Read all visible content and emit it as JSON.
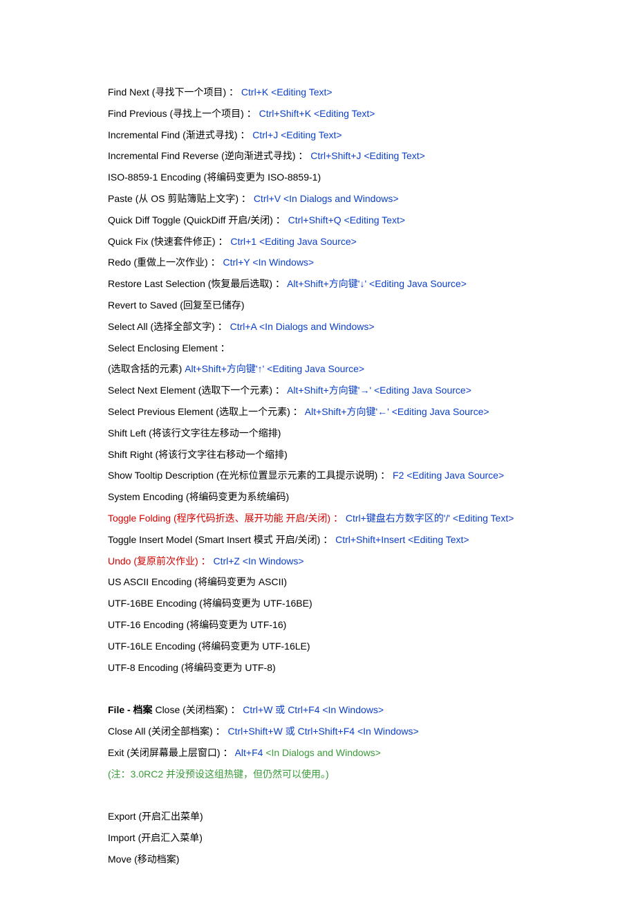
{
  "edit_lines": [
    [
      {
        "text": "Find Next (寻找下一个项目) ： ",
        "color": "black"
      },
      {
        "text": "Ctrl+K <Editing Text>",
        "color": "blue"
      }
    ],
    [
      {
        "text": "Find Previous (寻找上一个项目) ： ",
        "color": "black"
      },
      {
        "text": "Ctrl+Shift+K <Editing Text>",
        "color": "blue"
      }
    ],
    [
      {
        "text": "Incremental Find (渐进式寻找) ： ",
        "color": "black"
      },
      {
        "text": "Ctrl+J <Editing Text>",
        "color": "blue"
      }
    ],
    [
      {
        "text": "Incremental Find Reverse (逆向渐进式寻找) ： ",
        "color": "black"
      },
      {
        "text": "Ctrl+Shift+J <Editing Text>",
        "color": "blue"
      }
    ],
    [
      {
        "text": "ISO-8859-1 Encoding (将编码变更为 ISO-8859-1)",
        "color": "black"
      }
    ],
    [
      {
        "text": "Paste (从 OS 剪贴簿贴上文字) ： ",
        "color": "black"
      },
      {
        "text": "Ctrl+V <In Dialogs and Windows>",
        "color": "blue"
      }
    ],
    [
      {
        "text": "Quick Diff Toggle (QuickDiff 开启/关闭) ： ",
        "color": "black"
      },
      {
        "text": "Ctrl+Shift+Q <Editing Text>",
        "color": "blue"
      }
    ],
    [
      {
        "text": "Quick Fix (快速套件修正) ： ",
        "color": "black"
      },
      {
        "text": "Ctrl+1 <Editing Java Source>",
        "color": "blue"
      }
    ],
    [
      {
        "text": "Redo (重做上一次作业) ： ",
        "color": "black"
      },
      {
        "text": "Ctrl+Y <In Windows>",
        "color": "blue"
      }
    ],
    [
      {
        "text": "Restore Last Selection (恢复最后选取) ： ",
        "color": "black"
      },
      {
        "text": "Alt+Shift+方向键'↓' <Editing Java Source>",
        "color": "blue"
      }
    ],
    [
      {
        "text": "Revert to Saved (回复至已储存)",
        "color": "black"
      }
    ],
    [
      {
        "text": "Select All (选择全部文字) ： ",
        "color": "black"
      },
      {
        "text": "Ctrl+A <In Dialogs and Windows>",
        "color": "blue"
      }
    ],
    [
      {
        "text": "Select Enclosing Element ：",
        "color": "black"
      }
    ],
    [
      {
        "text": "(选取含括的元素) ",
        "color": "black"
      },
      {
        "text": "Alt+Shift+方向键'↑' <Editing Java Source>",
        "color": "blue"
      }
    ],
    [
      {
        "text": "Select Next Element (选取下一个元素) ： ",
        "color": "black"
      },
      {
        "text": "Alt+Shift+方向键'→' <Editing Java Source>",
        "color": "blue"
      }
    ],
    [
      {
        "text": "Select Previous Element (选取上一个元素) ： ",
        "color": "black"
      },
      {
        "text": "Alt+Shift+方向键'←' <Editing Java Source>",
        "color": "blue"
      }
    ],
    [
      {
        "text": "Shift Left (将该行文字往左移动一个缩排)",
        "color": "black"
      }
    ],
    [
      {
        "text": "Shift Right (将该行文字往右移动一个缩排)",
        "color": "black"
      }
    ],
    [
      {
        "text": "Show Tooltip Description (在光标位置显示元素的工具提示说明) ： ",
        "color": "black"
      },
      {
        "text": "F2 <Editing Java Source>",
        "color": "blue"
      }
    ],
    [
      {
        "text": "System Encoding (将编码变更为系统编码)",
        "color": "black"
      }
    ],
    [
      {
        "text": "Toggle Folding (程序代码折迭、展开功能 开启/关闭) ： ",
        "color": "red"
      },
      {
        "text": "Ctrl+键盘右方数字区的'/' <Editing Text>",
        "color": "blue"
      }
    ],
    [
      {
        "text": "Toggle Insert Model (Smart Insert 模式 开启/关闭) ： ",
        "color": "black"
      },
      {
        "text": "Ctrl+Shift+Insert <Editing Text>",
        "color": "blue"
      }
    ],
    [
      {
        "text": "Undo (复原前次作业) ： ",
        "color": "red"
      },
      {
        "text": "Ctrl+Z <In Windows>",
        "color": "blue"
      }
    ],
    [
      {
        "text": "US ASCII Encoding (将编码变更为 ASCII)",
        "color": "black"
      }
    ],
    [
      {
        "text": "UTF-16BE Encoding (将编码变更为 UTF-16BE)",
        "color": "black"
      }
    ],
    [
      {
        "text": "UTF-16 Encoding (将编码变更为 UTF-16)",
        "color": "black"
      }
    ],
    [
      {
        "text": "UTF-16LE Encoding (将编码变更为 UTF-16LE)",
        "color": "black"
      }
    ],
    [
      {
        "text": "UTF-8 Encoding (将编码变更为 UTF-8)",
        "color": "black"
      }
    ]
  ],
  "file_heading_parts": [
    {
      "text": "File - 档案 ",
      "color": "black",
      "bold": true
    },
    {
      "text": "Close (关闭档案) ： ",
      "color": "black"
    },
    {
      "text": "Ctrl+W 或 Ctrl+F4 <In Windows>",
      "color": "blue"
    }
  ],
  "file_lines": [
    [
      {
        "text": "Close All (关闭全部档案) ： ",
        "color": "black"
      },
      {
        "text": "Ctrl+Shift+W 或 Ctrl+Shift+F4 <In Windows>",
        "color": "blue"
      }
    ],
    [
      {
        "text": "Exit (关闭屏幕最上层窗口) ： ",
        "color": "black"
      },
      {
        "text": "Alt+F4 ",
        "color": "blue"
      },
      {
        "text": "<In Dialogs and Windows>",
        "color": "green"
      }
    ],
    [
      {
        "text": "(注：3.0RC2 并没预设这组热键，但仍然可以使用。)",
        "color": "green"
      }
    ]
  ],
  "file_lines2": [
    [
      {
        "text": "Export (开启汇出菜单)",
        "color": "black"
      }
    ],
    [
      {
        "text": "Import (开启汇入菜单)",
        "color": "black"
      }
    ],
    [
      {
        "text": "Move (移动档案)",
        "color": "black"
      }
    ]
  ]
}
